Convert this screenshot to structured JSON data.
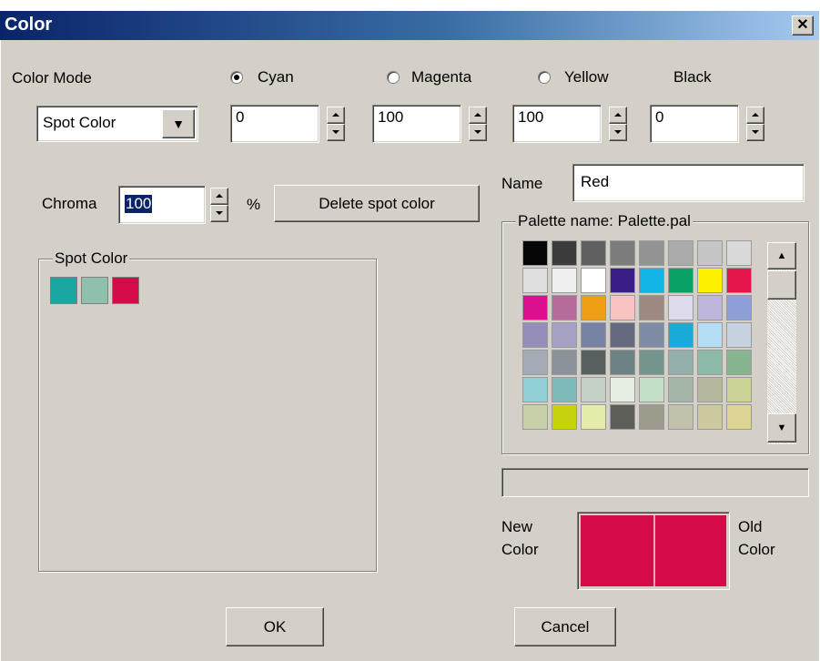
{
  "window": {
    "title": "Color",
    "close_glyph": "✕"
  },
  "color_mode": {
    "label": "Color Mode",
    "selected": "Spot Color",
    "dropdown_glyph": "▼"
  },
  "channels": {
    "cyan": {
      "label": "Cyan",
      "value": "0",
      "selected": true
    },
    "magenta": {
      "label": "Magenta",
      "value": "100",
      "selected": false
    },
    "yellow": {
      "label": "Yellow",
      "value": "100",
      "selected": false
    },
    "black": {
      "label": "Black",
      "value": "0"
    }
  },
  "chroma": {
    "label": "Chroma",
    "value": "100",
    "unit": "%"
  },
  "delete_button": "Delete spot color",
  "name": {
    "label": "Name",
    "value": "Red"
  },
  "spot_group": {
    "title": "Spot Color",
    "swatches": [
      "#1aa7a2",
      "#8fbfad",
      "#d50a48"
    ]
  },
  "palette": {
    "title": "Palette name: Palette.pal",
    "scroll_up_glyph": "▲",
    "scroll_down_glyph": "▼",
    "colors": [
      "#050505",
      "#3b3b3b",
      "#616161",
      "#7c7c7c",
      "#939393",
      "#ababab",
      "#c5c5c5",
      "#dadada",
      "#dfdfdf",
      "#f0f0f0",
      "#ffffff",
      "#3a1d86",
      "#12b3e5",
      "#0aa167",
      "#fff200",
      "#e3154b",
      "#dc0f8f",
      "#b66c9a",
      "#ef9d12",
      "#f7c2c0",
      "#9d8980",
      "#dedaee",
      "#bdb6da",
      "#8e9ed6",
      "#948db8",
      "#a5a1c2",
      "#7683a3",
      "#646b7f",
      "#7d8ca4",
      "#1aaad9",
      "#b5ddf3",
      "#c6d2e0",
      "#a3acb6",
      "#8a929a",
      "#58605f",
      "#6d8283",
      "#73958d",
      "#94aeac",
      "#8cb9a8",
      "#88b48f",
      "#91d0d6",
      "#7fbabb",
      "#c3d0c5",
      "#e6ede3",
      "#c4dfc7",
      "#a4b7a7",
      "#b5b89c",
      "#ccd396",
      "#c7d0a8",
      "#c5d20d",
      "#e5ebaa",
      "#5e5f59",
      "#9d9c8c",
      "#c2c1ab",
      "#cdc99e",
      "#ddd596"
    ]
  },
  "status_field": "",
  "preview": {
    "new_label_1": "New",
    "new_label_2": "Color",
    "old_label_1": "Old",
    "old_label_2": "Color",
    "new_color": "#d50a48",
    "old_color": "#d50a48"
  },
  "buttons": {
    "ok": "OK",
    "cancel": "Cancel"
  }
}
